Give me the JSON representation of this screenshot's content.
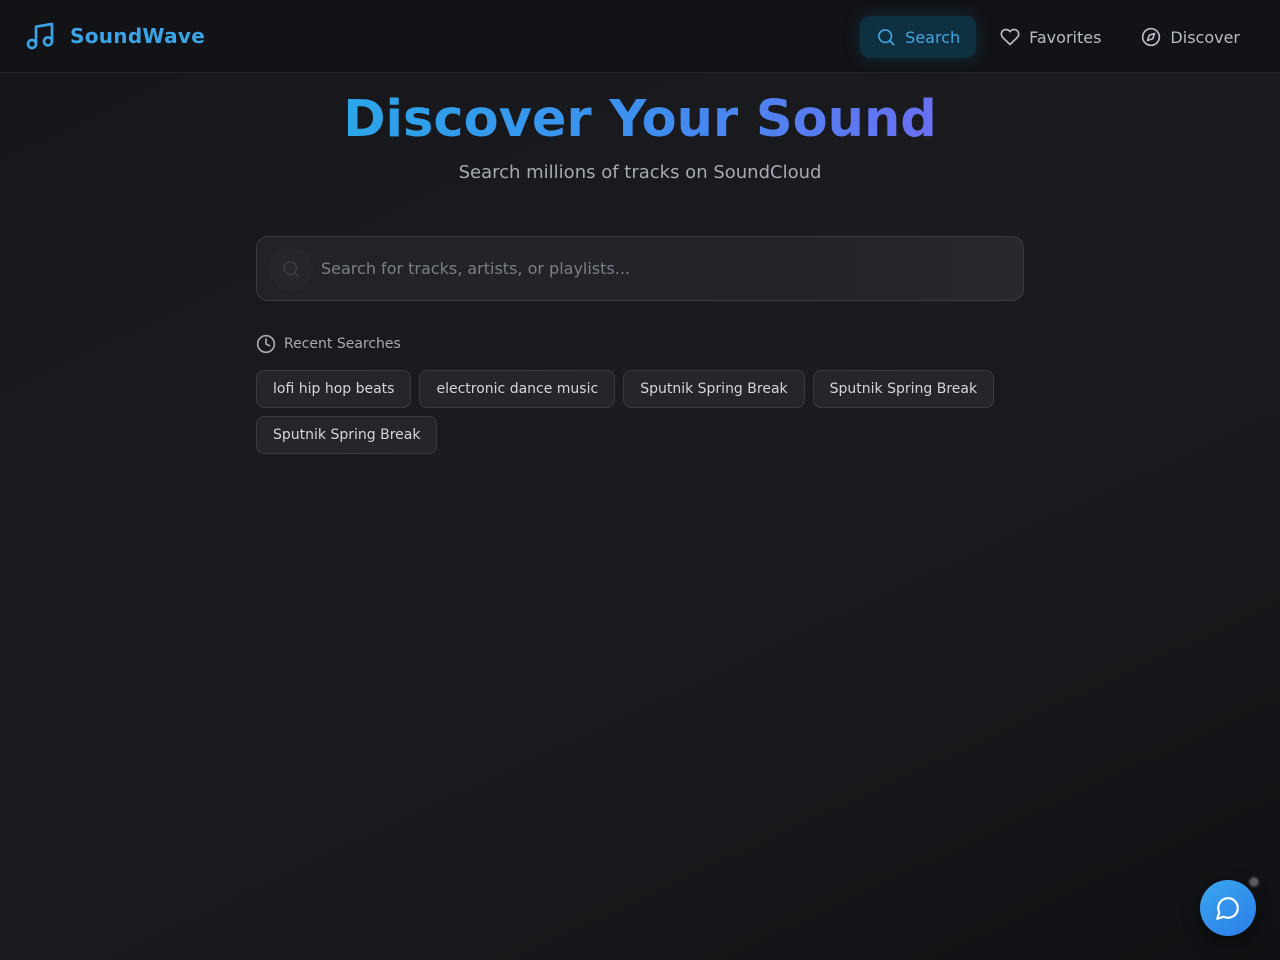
{
  "app": {
    "name": "SoundWave"
  },
  "nav": {
    "items": [
      {
        "label": "Search",
        "icon": "search-icon",
        "active": true
      },
      {
        "label": "Favorites",
        "icon": "heart-icon",
        "active": false
      },
      {
        "label": "Discover",
        "icon": "compass-icon",
        "active": false
      }
    ]
  },
  "hero": {
    "title": "Discover Your Sound",
    "subtitle": "Search millions of tracks on SoundCloud"
  },
  "search": {
    "placeholder": "Search for tracks, artists, or playlists...",
    "value": ""
  },
  "recent": {
    "label": "Recent Searches",
    "items": [
      "lofi hip hop beats",
      "electronic dance music",
      "Sputnik Spring Break",
      "Sputnik Spring Break",
      "Sputnik Spring Break"
    ]
  },
  "colors": {
    "accent": "#3ba4e6",
    "gradient_start": "#2ba5e8",
    "gradient_end": "#6a6ff2",
    "background": "#17181b"
  }
}
